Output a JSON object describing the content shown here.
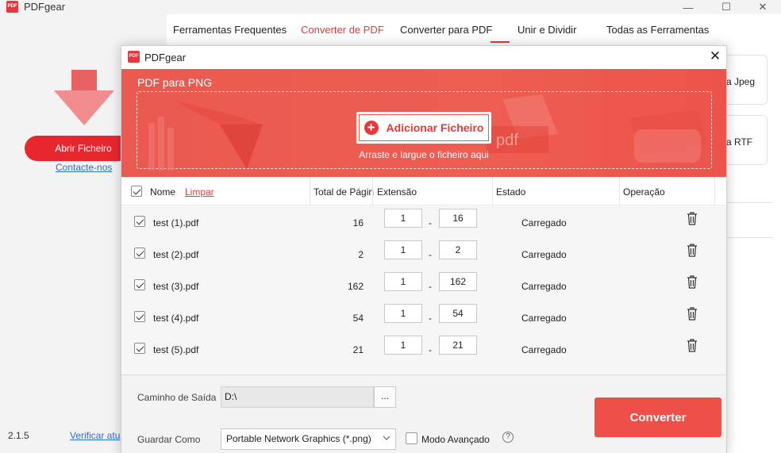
{
  "app": {
    "title": "PDFgear",
    "logo_text": "PDF"
  },
  "window_controls": {
    "minimize": "—",
    "maximize": "☐",
    "close": "✕"
  },
  "sidebar": {
    "open_file": "Abrir Ficheiro",
    "contact": "Contacte-nos",
    "version": "2.1.5",
    "check_updates": "Verificar atu"
  },
  "nav": {
    "tabs": [
      {
        "label": "Ferramentas Frequentes"
      },
      {
        "label": "Converter de PDF"
      },
      {
        "label": "Converter para PDF"
      },
      {
        "label": "Unir e Dividir"
      },
      {
        "label": "Todas as Ferramentas"
      }
    ],
    "active_tab": "Converter de PDF"
  },
  "background_cards": [
    {
      "label": "a Jpeg"
    },
    {
      "label": "a RTF"
    }
  ],
  "dialog": {
    "title": "PDFgear",
    "close": "✕",
    "banner_title": "PDF para PNG",
    "add_file": "Adicionar Ficheiro",
    "drag_hint": "Arraste e largue o ficheiro aqui",
    "table": {
      "headers": {
        "name": "Nome",
        "clear": "Limpar",
        "total_pages": "Total de Págin",
        "range": "Extensão",
        "status": "Estado",
        "operation": "Operação"
      },
      "rows": [
        {
          "name": "test (1).pdf",
          "pages": "16",
          "from": "1",
          "to": "16",
          "status": "Carregado"
        },
        {
          "name": "test (2).pdf",
          "pages": "2",
          "from": "1",
          "to": "2",
          "status": "Carregado"
        },
        {
          "name": "test (3).pdf",
          "pages": "162",
          "from": "1",
          "to": "162",
          "status": "Carregado"
        },
        {
          "name": "test (4).pdf",
          "pages": "54",
          "from": "1",
          "to": "54",
          "status": "Carregado"
        },
        {
          "name": "test (5).pdf",
          "pages": "21",
          "from": "1",
          "to": "21",
          "status": "Carregado"
        }
      ],
      "range_separator": "-"
    },
    "footer": {
      "output_path_label": "Caminho de Saída",
      "output_path_value": "D:\\",
      "browse": "...",
      "save_as_label": "Guardar Como",
      "save_as_value": "Portable Network Graphics (*.png)",
      "advanced_mode": "Modo Avançado",
      "help": "?",
      "convert": "Converter"
    }
  },
  "colors": {
    "accent": "#e8363a",
    "banner": "#ee5d52",
    "convert": "#ee5049",
    "link": "#2b6bd6"
  }
}
